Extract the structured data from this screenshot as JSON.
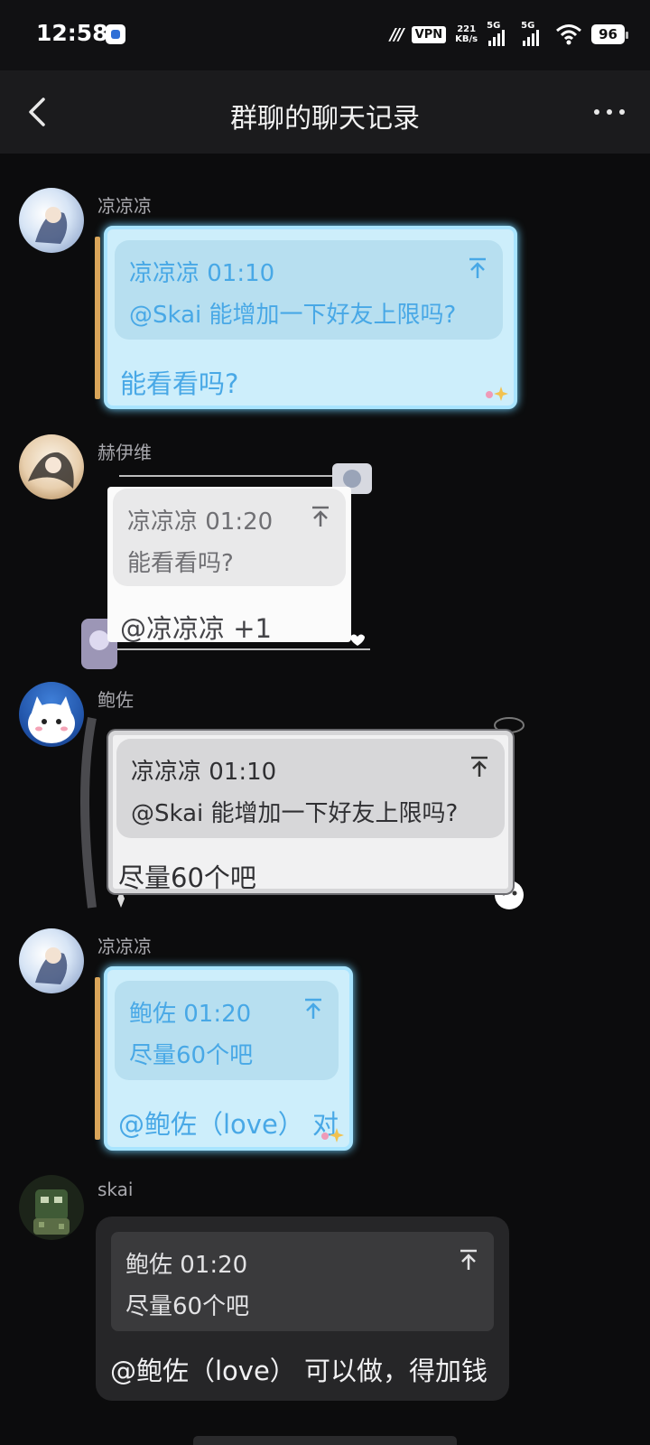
{
  "status_bar": {
    "time": "12:58",
    "vpn": "VPN",
    "speed_value": "221",
    "speed_unit": "KB/s",
    "signal1": "5G",
    "signal2": "5G",
    "battery": "96"
  },
  "nav": {
    "title": "群聊的聊天记录"
  },
  "messages": [
    {
      "sender": "凉凉凉",
      "quote_header": "凉凉凉 01:10",
      "quote_body": "@Skai  能增加一下好友上限吗?",
      "text": "能看看吗?"
    },
    {
      "sender": "赫伊维",
      "quote_header": "凉凉凉 01:20",
      "quote_body": "能看看吗?",
      "text": "@凉凉凉 +1"
    },
    {
      "sender": "鲍佐",
      "quote_header": "凉凉凉 01:10",
      "quote_body": "@Skai  能增加一下好友上限吗?",
      "text": "尽量60个吧"
    },
    {
      "sender": "凉凉凉",
      "quote_header": "鲍佐 01:20",
      "quote_body": "尽量60个吧",
      "text": "@鲍佐（love） 对"
    },
    {
      "sender": "skai",
      "quote_header": "鲍佐 01:20",
      "quote_body": "尽量60个吧",
      "text": "@鲍佐（love） 可以做，得加钱"
    }
  ],
  "colors": {
    "background": "#0c0c0d",
    "blue_bubble": "#cdeefb",
    "blue_text": "#48a8e6",
    "dark_bubble": "#262628"
  },
  "icons": {
    "back": "chevron-left-icon",
    "more": "more-dots-icon",
    "quote_top": "arrow-to-top-icon"
  }
}
